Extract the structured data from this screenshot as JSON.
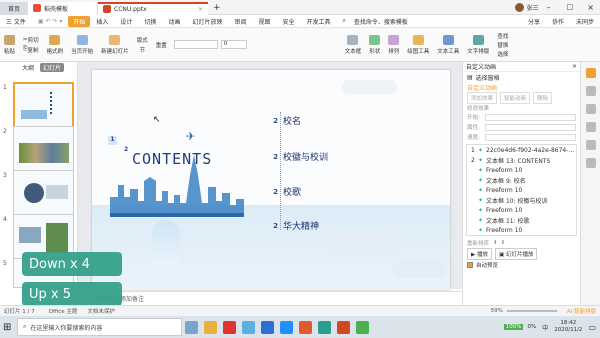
{
  "titlebar": {
    "home_tab": "首页",
    "tab1": "稻壳模板",
    "tab2": "CCNU.pptx",
    "new_tab": "+",
    "user": "张三"
  },
  "menubar": {
    "file": "三 文件",
    "items": [
      "开始",
      "插入",
      "设计",
      "切换",
      "动画",
      "幻灯片放映",
      "审阅",
      "视图",
      "安全",
      "开发工具"
    ],
    "search": "查找命令、搜索模板",
    "share": "分享",
    "collab": "协作",
    "sync": "未同步"
  },
  "ribbon": {
    "items": [
      "粘贴",
      "剪切",
      "复制",
      "格式刷",
      "当页开始",
      "新建幻灯片",
      "版式",
      "节",
      "重置",
      "文本框",
      "形状",
      "排列",
      "绘图工具",
      "文本工具",
      "文字排版",
      "查找",
      "替换",
      "选择"
    ],
    "font_size": "0"
  },
  "leftpane": {
    "tab_outline": "大纲",
    "tab_slides": "幻灯片",
    "thumb_numbers": [
      "1",
      "2",
      "3",
      "4",
      "5"
    ]
  },
  "slide": {
    "contents_title": "CONTENTS",
    "title_num": "1",
    "title_num2": "2",
    "toc": [
      {
        "num": "2",
        "label": "校名"
      },
      {
        "num": "2",
        "label": "校徽与校训"
      },
      {
        "num": "2",
        "label": "校歌"
      },
      {
        "num": "2",
        "label": "华大精神"
      }
    ]
  },
  "notes_placeholder": "单击此处添加备注",
  "rightpane": {
    "title": "自定义动画",
    "select_pane": "选择窗格",
    "custom_anim": "自定义动画",
    "add_effect": "添加效果",
    "smart_anim": "智能动画",
    "delete": "删除",
    "modify": "修改效果",
    "start_label": "开始:",
    "prop_label": "属性:",
    "speed_label": "速度:",
    "list": [
      {
        "num": "1",
        "text": "22c0e4d6-f902-4a2e-8674-..."
      },
      {
        "num": "2",
        "text": "文本框 13: CONTENTS"
      },
      {
        "num": "",
        "text": "Freeform 10"
      },
      {
        "num": "",
        "text": "文本框 9: 校名"
      },
      {
        "num": "",
        "text": "Freeform 10"
      },
      {
        "num": "",
        "text": "文本框 10: 校徽与校训"
      },
      {
        "num": "",
        "text": "Freeform 10"
      },
      {
        "num": "",
        "text": "文本框 11: 校歌"
      },
      {
        "num": "",
        "text": "Freeform 10"
      }
    ],
    "reorder": "重新排序",
    "play": "播放",
    "slideshow": "幻灯片播放",
    "autopreview": "自动预览"
  },
  "overlays": {
    "down": "Down x 4",
    "up": "Up x 5"
  },
  "statusbar": {
    "slide_info": "幻灯片 1 / 7",
    "theme": "Office 主题",
    "doc_status": "文档未保护",
    "zoom": "59%",
    "ai": "AI·智能排版"
  },
  "taskbar": {
    "search_placeholder": "在这里输入你要搜索的内容",
    "time": "18:42",
    "date": "2020/11/2",
    "battery": "100%",
    "temp": "0%",
    "ime": "中"
  }
}
